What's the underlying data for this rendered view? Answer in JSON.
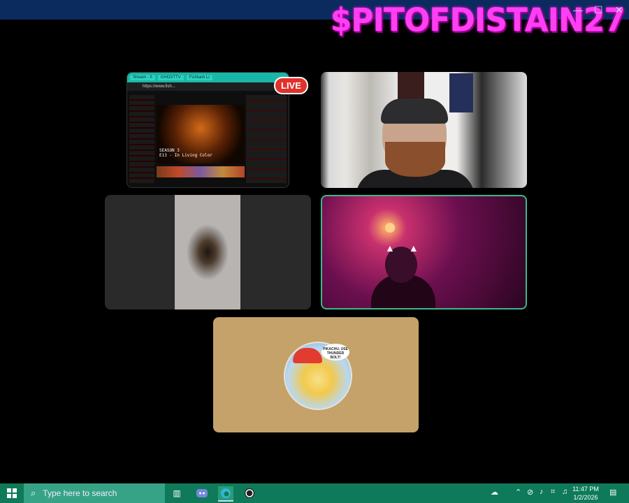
{
  "overlay": {
    "watermark": "$PITOFDISTAIN27"
  },
  "window": {
    "minimize": "—",
    "maximize": "☐",
    "close": "✕"
  },
  "screenshare": {
    "tabs": [
      "Stream - fi",
      "GHOSTTV",
      "Fishtank Li"
    ],
    "url": "https://www.fish...",
    "caption_line1": "SEASON 3",
    "caption_line2": "E13 - In Living Color",
    "live_badge": "LIVE"
  },
  "avatar_tile": {
    "bubble_text": "PIKACHU, USE THUNDER BOLT!"
  },
  "taskbar": {
    "search_placeholder": "Type here to search",
    "time": "11:47 PM",
    "date": "1/2/2026"
  },
  "colors": {
    "accent": "#0e7a5a",
    "live": "#e0322b",
    "watermark": "#ff3ff2",
    "speaking_border": "#3bb78f",
    "avatar_bg": "#c4a26a"
  }
}
